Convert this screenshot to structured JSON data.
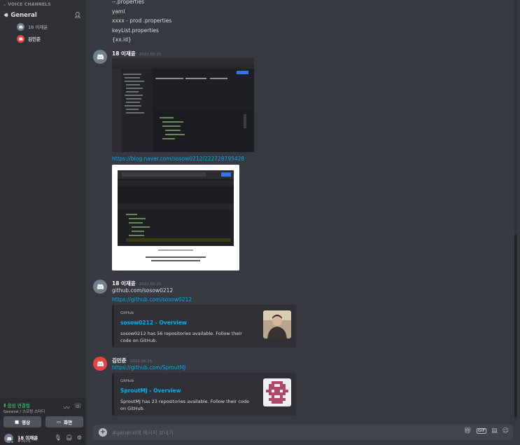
{
  "sidebar": {
    "section_header": "VOICE CHANNELS",
    "channel_name": "General",
    "voice_users": [
      "18 이재윤",
      "김민준"
    ],
    "voice_status": "음성 연결됨",
    "voice_location": "General / 스프링 스터디",
    "video_label": "영상",
    "screen_label": "화면",
    "user": {
      "name": "18 이재윤",
      "tag": "#7071"
    }
  },
  "prev_lines": [
    "--.properties",
    "yaml",
    "xxxx - prod .properties",
    "keyList.properties",
    "{xx.id}"
  ],
  "messages": [
    {
      "author": "18 이재윤",
      "timestamp": "2022.05.15.",
      "link": "https://blog.naver.com/sosow0212/222728795428"
    },
    {
      "author": "18 이재윤",
      "timestamp": "2022.05.15.",
      "text": "github.com/sosow0212",
      "link": "https://github.com/sosow0212",
      "embed": {
        "provider": "GitHub",
        "title": "sosow0212 - Overview",
        "description": "sosow0212 has 56 repositories available. Follow their code on GitHub."
      }
    },
    {
      "author": "김민준",
      "timestamp": "2022.05.15.",
      "link": "https://github.com/SproutMJ",
      "embed": {
        "provider": "GitHub",
        "title": "SproutMJ - Overview",
        "description": "SproutMJ has 23 repositories available. Follow their code on GitHub."
      }
    }
  ],
  "composer": {
    "placeholder": "#general에 메시지 보내기"
  },
  "colors": {
    "link": "#00aff4",
    "online": "#3ba55c",
    "avatar_grey": "#747f8d",
    "avatar_red": "#ed4245"
  }
}
